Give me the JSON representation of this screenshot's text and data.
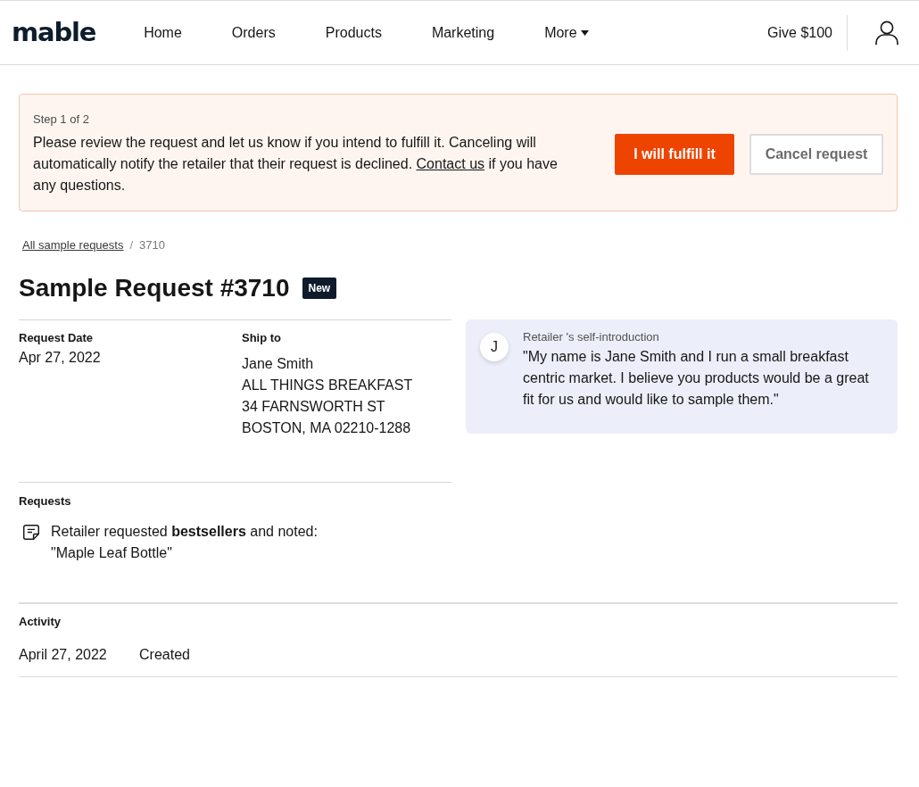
{
  "header": {
    "logo": "mable",
    "nav": [
      {
        "label": "Home",
        "kind": "link"
      },
      {
        "label": "Orders",
        "kind": "link"
      },
      {
        "label": "Products",
        "kind": "link"
      },
      {
        "label": "Marketing",
        "kind": "link"
      },
      {
        "label": "More",
        "kind": "dropdown"
      }
    ],
    "give": "Give $100"
  },
  "banner": {
    "step": "Step 1 of 2",
    "message": {
      "before": "Please review the request and let us know if you intend to fulfill it. Canceling will automatically notify the retailer that their request is declined.",
      "link": "Contact us",
      "after": "if you have any questions."
    },
    "buttons": [
      {
        "label": "I will fulfill it",
        "kind": "primary"
      },
      {
        "label": "Cancel request",
        "kind": "secondary"
      }
    ]
  },
  "breadcrumb": {
    "items": [
      {
        "label": "All sample requests",
        "kind": "link"
      },
      {
        "label": "3710",
        "kind": "current"
      }
    ],
    "separator": "/"
  },
  "page": {
    "title": "Sample Request #3710",
    "badge": "New"
  },
  "details": {
    "request_date": {
      "label": "Request Date",
      "value": "Apr 27, 2022"
    },
    "ship_to": {
      "label": "Ship to",
      "lines": [
        "Jane Smith",
        "ALL THINGS BREAKFAST",
        "34 FARNSWORTH ST",
        "BOSTON, MA 02210-1288"
      ]
    }
  },
  "introduction": {
    "avatar": "J",
    "label": "Retailer 's self-introduction",
    "text": "\"My name is Jane Smith and I run a small breakfast centric market. I believe you products would be a great fit for us and would like to sample them.\""
  },
  "requests": {
    "heading": "Requests",
    "items": [
      {
        "text": "Retailer requested **bestsellers** and noted:",
        "note": "\"Maple Leaf Bottle\""
      }
    ]
  },
  "activity": {
    "heading": "Activity",
    "rows": [
      {
        "date": "April 27, 2022",
        "event": "Created"
      }
    ]
  }
}
